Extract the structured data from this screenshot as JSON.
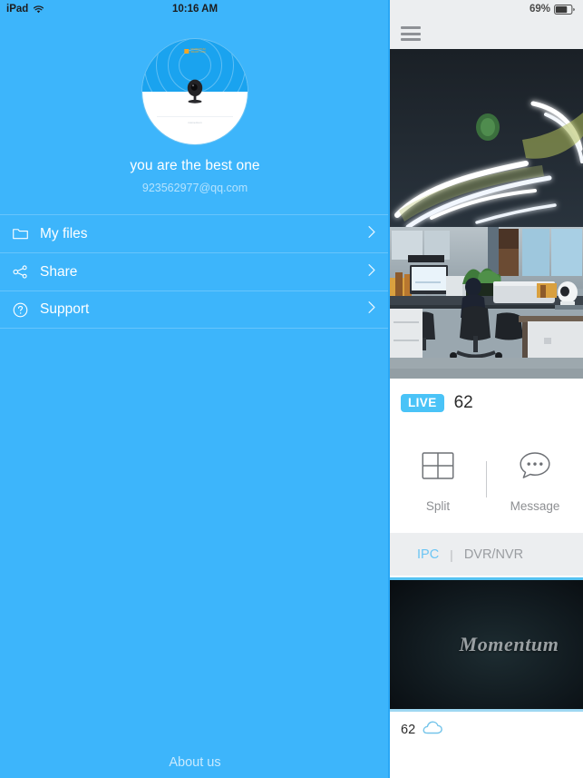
{
  "sidebar": {
    "status_bar": {
      "device": "iPad",
      "wifi_icon": "wifi-icon",
      "time": "10:16 AM"
    },
    "profile": {
      "avatar_icon": "security-camera-avatar",
      "avatar_brand_text": "MOMENTUM\nSMART CAM",
      "avatar_footer_text": "momentum",
      "username": "you are the best one",
      "email": "923562977@qq.com"
    },
    "items": [
      {
        "label": "My files",
        "icon": "folder-icon",
        "chevron": "chevron-right-icon"
      },
      {
        "label": "Share",
        "icon": "share-icon",
        "chevron": "chevron-right-icon"
      },
      {
        "label": "Support",
        "icon": "question-circle-icon",
        "chevron": "chevron-right-icon"
      }
    ],
    "footer": {
      "about_label": "About us"
    }
  },
  "right_panel": {
    "status_bar": {
      "battery_percent": "69%",
      "battery_icon": "battery-icon"
    },
    "navbar": {
      "menu_icon": "hamburger-menu-icon"
    },
    "video": {
      "alt": "live-camera-feed-office"
    },
    "live": {
      "badge": "LIVE",
      "device_id": "62"
    },
    "actions": [
      {
        "label": "Split",
        "icon": "grid-split-icon"
      },
      {
        "label": "Message",
        "icon": "message-bubble-icon"
      }
    ],
    "tabs": [
      {
        "label": "IPC",
        "active": true
      },
      {
        "label": "DVR/NVR",
        "active": false
      }
    ],
    "tab_separator": "|",
    "thumbnail": {
      "overlay_text": "Momentum",
      "alt": "camera-thumbnail"
    },
    "thumbnail_meta": {
      "name": "62",
      "cloud_icon": "cloud-icon"
    }
  },
  "colors": {
    "sidebar_blue": "#3db5fb",
    "accent_blue": "#4ac3f7",
    "tab_active": "#6cc5f4",
    "panel_gray": "#eceef0",
    "text_dark": "#2b2b2b",
    "text_muted": "#8d8f92"
  }
}
